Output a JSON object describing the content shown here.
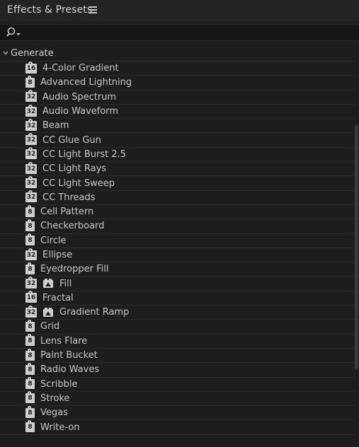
{
  "panel": {
    "title": "Effects & Presets",
    "menu_icon": "hamburger-icon"
  },
  "search": {
    "icon": "search-icon",
    "placeholder": "",
    "value": ""
  },
  "category": {
    "label": "Generate",
    "expanded": true,
    "icon": "chevron-down-icon"
  },
  "items": [
    {
      "label": "4-Color Gradient",
      "badge": "16",
      "fx": false
    },
    {
      "label": "Advanced Lightning",
      "badge": "8",
      "fx": false
    },
    {
      "label": "Audio Spectrum",
      "badge": "32",
      "fx": false
    },
    {
      "label": "Audio Waveform",
      "badge": "32",
      "fx": false
    },
    {
      "label": "Beam",
      "badge": "32",
      "fx": false
    },
    {
      "label": "CC Glue Gun",
      "badge": "32",
      "fx": false
    },
    {
      "label": "CC Light Burst 2.5",
      "badge": "32",
      "fx": false
    },
    {
      "label": "CC Light Rays",
      "badge": "32",
      "fx": false
    },
    {
      "label": "CC Light Sweep",
      "badge": "32",
      "fx": false
    },
    {
      "label": "CC Threads",
      "badge": "32",
      "fx": false
    },
    {
      "label": "Cell Pattern",
      "badge": "8",
      "fx": false
    },
    {
      "label": "Checkerboard",
      "badge": "8",
      "fx": false
    },
    {
      "label": "Circle",
      "badge": "8",
      "fx": false
    },
    {
      "label": "Ellipse",
      "badge": "32",
      "fx": false
    },
    {
      "label": "Eyedropper Fill",
      "badge": "8",
      "fx": false
    },
    {
      "label": "Fill",
      "badge": "32",
      "fx": true
    },
    {
      "label": "Fractal",
      "badge": "16",
      "fx": false
    },
    {
      "label": "Gradient Ramp",
      "badge": "32",
      "fx": true
    },
    {
      "label": "Grid",
      "badge": "8",
      "fx": false
    },
    {
      "label": "Lens Flare",
      "badge": "8",
      "fx": false
    },
    {
      "label": "Paint Bucket",
      "badge": "8",
      "fx": false
    },
    {
      "label": "Radio Waves",
      "badge": "8",
      "fx": false
    },
    {
      "label": "Scribble",
      "badge": "8",
      "fx": false
    },
    {
      "label": "Stroke",
      "badge": "8",
      "fx": false
    },
    {
      "label": "Vegas",
      "badge": "8",
      "fx": false
    },
    {
      "label": "Write-on",
      "badge": "8",
      "fx": false
    }
  ],
  "colors": {
    "background": "#1d1d1d",
    "header": "#232323",
    "text": "#c9c9c9",
    "badge": "#cfcfcf",
    "divider": "#2c2c2c"
  }
}
